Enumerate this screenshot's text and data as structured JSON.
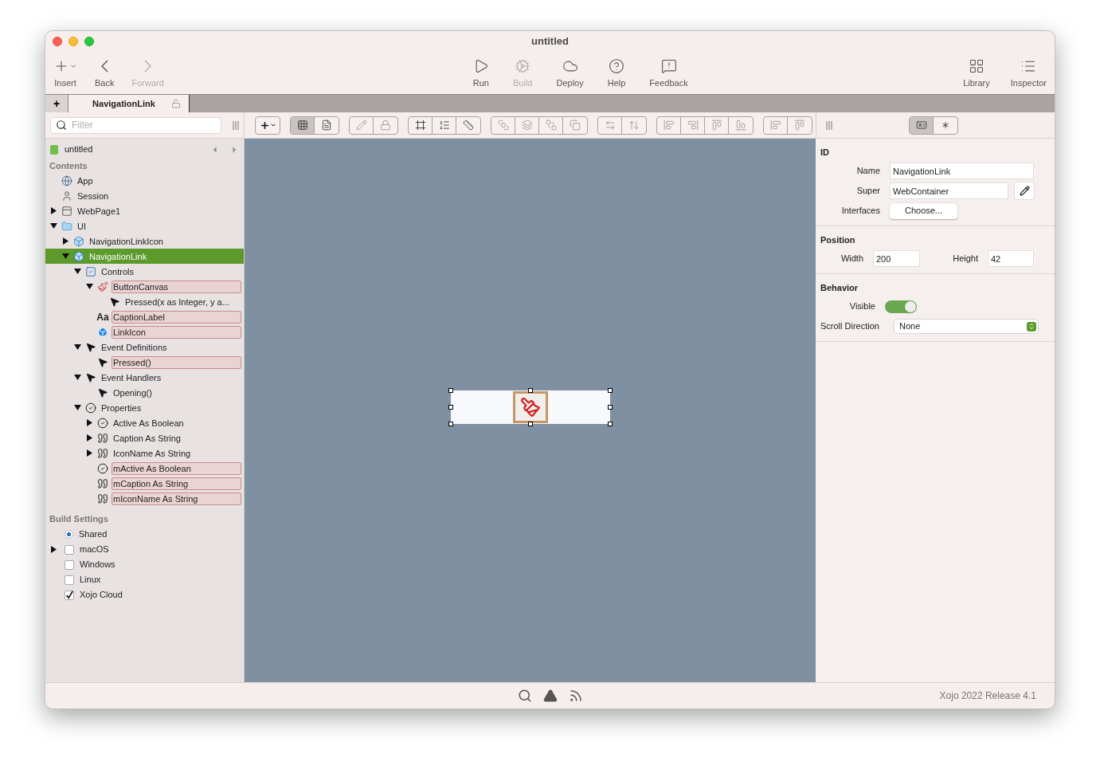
{
  "window": {
    "title": "untitled"
  },
  "toolbar": {
    "left": [
      {
        "label": "Insert",
        "disabled": false
      },
      {
        "label": "Back",
        "disabled": false
      },
      {
        "label": "Forward",
        "disabled": true
      }
    ],
    "center": [
      {
        "label": "Run",
        "disabled": false
      },
      {
        "label": "Build",
        "disabled": true
      },
      {
        "label": "Deploy",
        "disabled": false
      },
      {
        "label": "Help",
        "disabled": false
      },
      {
        "label": "Feedback",
        "disabled": false
      }
    ],
    "right": [
      {
        "label": "Library",
        "disabled": false
      },
      {
        "label": "Inspector",
        "disabled": false
      }
    ]
  },
  "tab_bar": {
    "add_label": "+",
    "tabs": [
      {
        "label": "NavigationLink",
        "selected": true
      }
    ]
  },
  "layout_toolbar": {
    "view_modes": [
      {
        "selected": true
      },
      {
        "selected": false
      }
    ]
  },
  "navigator": {
    "filter": {
      "placeholder": "Filter"
    },
    "project": "untitled",
    "contents_title": "Contents",
    "tree": [
      {
        "label": "App",
        "kind": "app",
        "selected": false,
        "highlighted": false
      },
      {
        "label": "Session",
        "kind": "session",
        "selected": false,
        "highlighted": false
      },
      {
        "label": "WebPage1",
        "kind": "webpage",
        "selected": false,
        "highlighted": false,
        "expanded": false
      },
      {
        "label": "UI",
        "kind": "folder",
        "selected": false,
        "highlighted": false,
        "expanded": true,
        "children": [
          {
            "label": "NavigationLinkIcon",
            "kind": "container",
            "selected": false,
            "highlighted": false,
            "expanded": false
          },
          {
            "label": "NavigationLink",
            "kind": "container",
            "selected": true,
            "highlighted": false,
            "expanded": true,
            "children": [
              {
                "label": "Controls",
                "kind": "controls",
                "selected": false,
                "highlighted": false,
                "expanded": true,
                "children": [
                  {
                    "label": "ButtonCanvas",
                    "kind": "canvas",
                    "selected": false,
                    "highlighted": true,
                    "expanded": true,
                    "children": [
                      {
                        "label": "Pressed(x as Integer, y a...",
                        "kind": "event",
                        "selected": false,
                        "highlighted": false
                      }
                    ]
                  },
                  {
                    "label": "CaptionLabel",
                    "kind": "label",
                    "icon_text": "Aa",
                    "selected": false,
                    "highlighted": true
                  },
                  {
                    "label": "LinkIcon",
                    "kind": "image",
                    "selected": false,
                    "highlighted": true
                  }
                ]
              },
              {
                "label": "Event Definitions",
                "kind": "event",
                "selected": false,
                "highlighted": false,
                "expanded": true,
                "children": [
                  {
                    "label": "Pressed()",
                    "kind": "event",
                    "selected": false,
                    "highlighted": true
                  }
                ]
              },
              {
                "label": "Event Handlers",
                "kind": "event",
                "selected": false,
                "highlighted": false,
                "expanded": true,
                "children": [
                  {
                    "label": "Opening()",
                    "kind": "event",
                    "selected": false,
                    "highlighted": false
                  }
                ]
              },
              {
                "label": "Properties",
                "kind": "boolean",
                "selected": false,
                "highlighted": false,
                "expanded": true,
                "children": [
                  {
                    "label": "Active As Boolean",
                    "kind": "boolean",
                    "selected": false,
                    "highlighted": false,
                    "expanded": false
                  },
                  {
                    "label": "Caption As String",
                    "kind": "string",
                    "selected": false,
                    "highlighted": false,
                    "expanded": false
                  },
                  {
                    "label": "IconName As String",
                    "kind": "string",
                    "selected": false,
                    "highlighted": false,
                    "expanded": false
                  },
                  {
                    "label": "mActive As Boolean",
                    "kind": "boolean",
                    "selected": false,
                    "highlighted": true
                  },
                  {
                    "label": "mCaption As String",
                    "kind": "string",
                    "selected": false,
                    "highlighted": true
                  },
                  {
                    "label": "mIconName As String",
                    "kind": "string",
                    "selected": false,
                    "highlighted": true
                  }
                ]
              }
            ]
          }
        ]
      }
    ],
    "build_title": "Build Settings",
    "build": [
      {
        "label": "Shared",
        "kind": "radio",
        "checked": true
      },
      {
        "label": "macOS",
        "kind": "checkbox",
        "checked": false,
        "expanded": false
      },
      {
        "label": "Windows",
        "kind": "checkbox",
        "checked": false
      },
      {
        "label": "Linux",
        "kind": "checkbox",
        "checked": false
      },
      {
        "label": "Xojo Cloud",
        "kind": "checkbox",
        "checked": true
      }
    ]
  },
  "inspector": {
    "modes": [
      {
        "selected": true
      },
      {
        "selected": false
      }
    ],
    "sections": [
      {
        "title": "ID",
        "rows": [
          {
            "kind": "text",
            "label": "Name",
            "value": "NavigationLink"
          },
          {
            "kind": "text_edit",
            "label": "Super",
            "value": "WebContainer"
          },
          {
            "kind": "button",
            "label": "Interfaces",
            "value": "Choose..."
          }
        ]
      },
      {
        "title": "Position",
        "rows": [
          {
            "kind": "pair",
            "label": "Width",
            "value": "200",
            "label2": "Height",
            "value2": "42"
          }
        ]
      },
      {
        "title": "Behavior",
        "rows": [
          {
            "kind": "switch",
            "label": "Visible",
            "on": true
          },
          {
            "kind": "select",
            "label": "Scroll Direction",
            "value": "None"
          }
        ]
      }
    ]
  },
  "status_bar": {
    "version": "Xojo 2022 Release 4.1"
  }
}
